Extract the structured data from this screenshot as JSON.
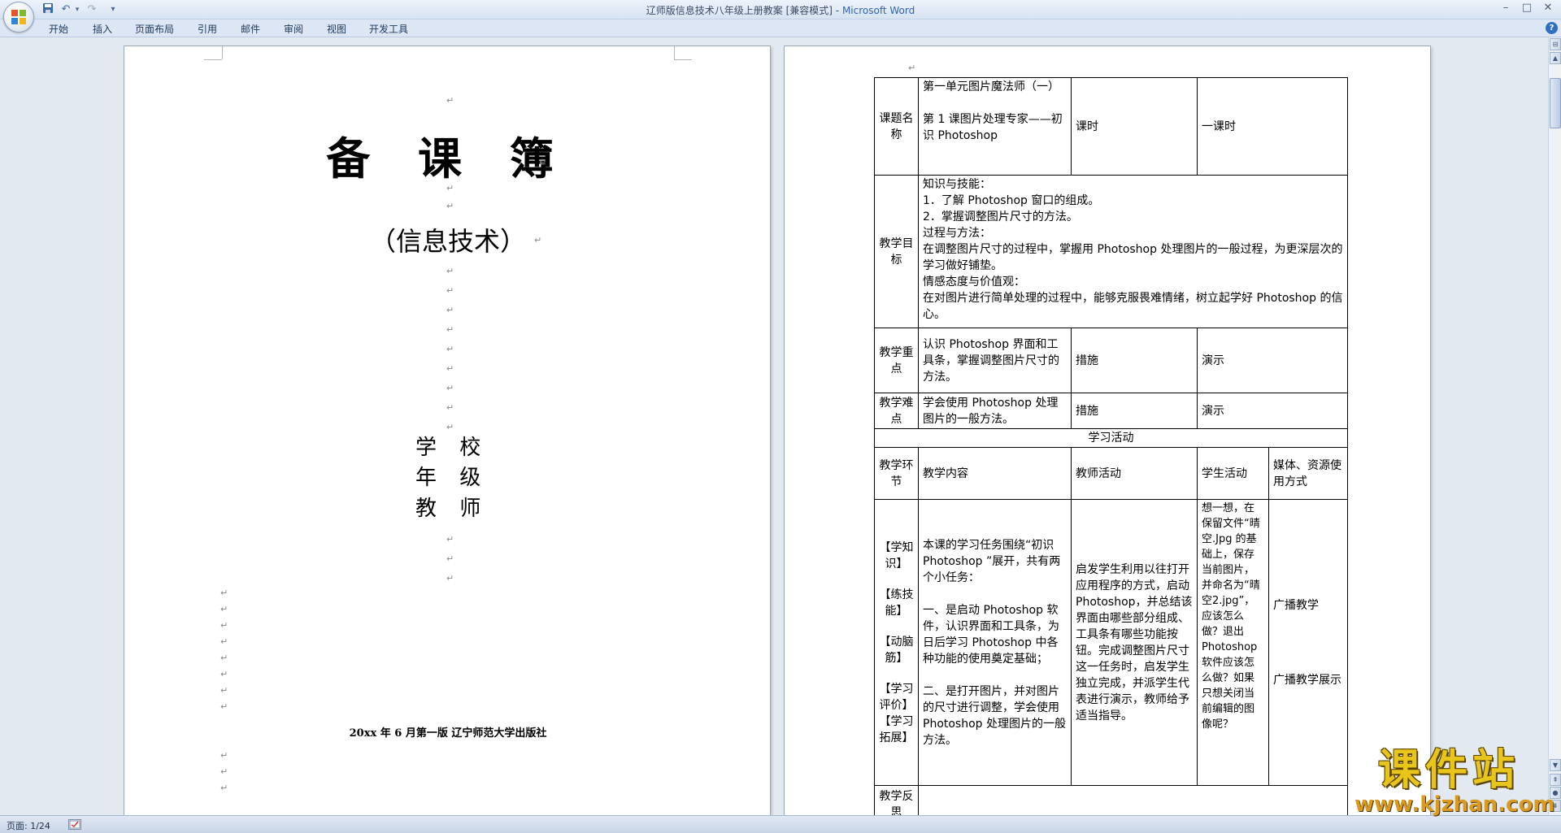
{
  "window": {
    "title": "辽师版信息技术八年级上册教案 [兼容模式]",
    "title_sep": " - ",
    "app": "Microsoft Word",
    "minimize": "–",
    "maximize": "□",
    "close": "✕"
  },
  "quick_access": {
    "save": "save-icon",
    "undo": "undo-icon",
    "redo": "redo-icon",
    "customize": "▾"
  },
  "ribbon": {
    "tabs": [
      "开始",
      "插入",
      "页面布局",
      "引用",
      "邮件",
      "审阅",
      "视图",
      "开发工具"
    ],
    "help": "?"
  },
  "cover": {
    "title": "备 课 簿",
    "subtitle": "（信息技术）",
    "fields": [
      "学 校",
      "年 级",
      "教 师"
    ],
    "publisher": "20xx 年 6 月第一版  辽宁师范大学出版社"
  },
  "lesson": {
    "topic_label": "课题名称",
    "topic_unit": "第一单元图片魔法师（一）",
    "topic_lesson": "第 1 课图片处理专家——初识 Photoshop",
    "hours_label": "课时",
    "hours_value": "一课时",
    "objectives_label": "教学目标",
    "objectives": [
      "知识与技能：",
      "1．了解 Photoshop 窗口的组成。",
      "2．掌握调整图片尺寸的方法。",
      "过程与方法：",
      "在调整图片尺寸的过程中，掌握用 Photoshop 处理图片的一般过程，为更深层次的学习做好铺垫。",
      "情感态度与价值观：",
      "在对图片进行简单处理的过程中，能够克服畏难情绪，树立起学好 Photoshop 的信心。"
    ],
    "keypoint_label": "教学重点",
    "keypoint": "认识 Photoshop 界面和工具条，掌握调整图片尺寸的方法。",
    "difficulty_label": "教学难点",
    "difficulty": "学会使用 Photoshop 处理图片的一般方法。",
    "measure_label": "措施",
    "measure_value": "演示",
    "activities_header": "学习活动",
    "col_stage": "教学环节",
    "col_content": "教学内容",
    "col_teacher": "教师活动",
    "col_student": "学生活动",
    "col_media": "媒体、资源使用方式",
    "stages": [
      "【学知识】",
      "【练技能】",
      "【动脑筋】",
      "【学习评价】",
      "【学习拓展】"
    ],
    "content_p1": "本课的学习任务围绕“初识 Photoshop ”展开，共有两个小任务：",
    "content_p2": "一、是启动 Photoshop 软件，认识界面和工具条，为日后学习 Photoshop 中各种功能的使用奠定基础；",
    "content_p3": "二、是打开图片，并对图片的尺寸进行调整，学会使用 Photoshop 处理图片的一般方法。",
    "teacher_activity": "启发学生利用以往打开应用程序的方式，启动 Photoshop，并总结该界面由哪些部分组成、工具条有哪些功能按钮。完成调整图片尺寸这一任务时，启发学生独立完成，并派学生代表进行演示，教师给予适当指导。",
    "student_activity": "想一想，在保留文件“晴空.Jpg 的基础上，保存当前图片，并命名为“晴空2.jpg”，应该怎么做？退出Photoshop 软件应该怎么做？如果只想关闭当前编辑的图像呢？",
    "media_1": "广播教学",
    "media_2": "广播教学展示",
    "reflection_label": "教学反思"
  },
  "status": {
    "page": "页面: 1/24"
  },
  "watermark": {
    "title": "课件站",
    "url": "www.kjzhan.com"
  }
}
